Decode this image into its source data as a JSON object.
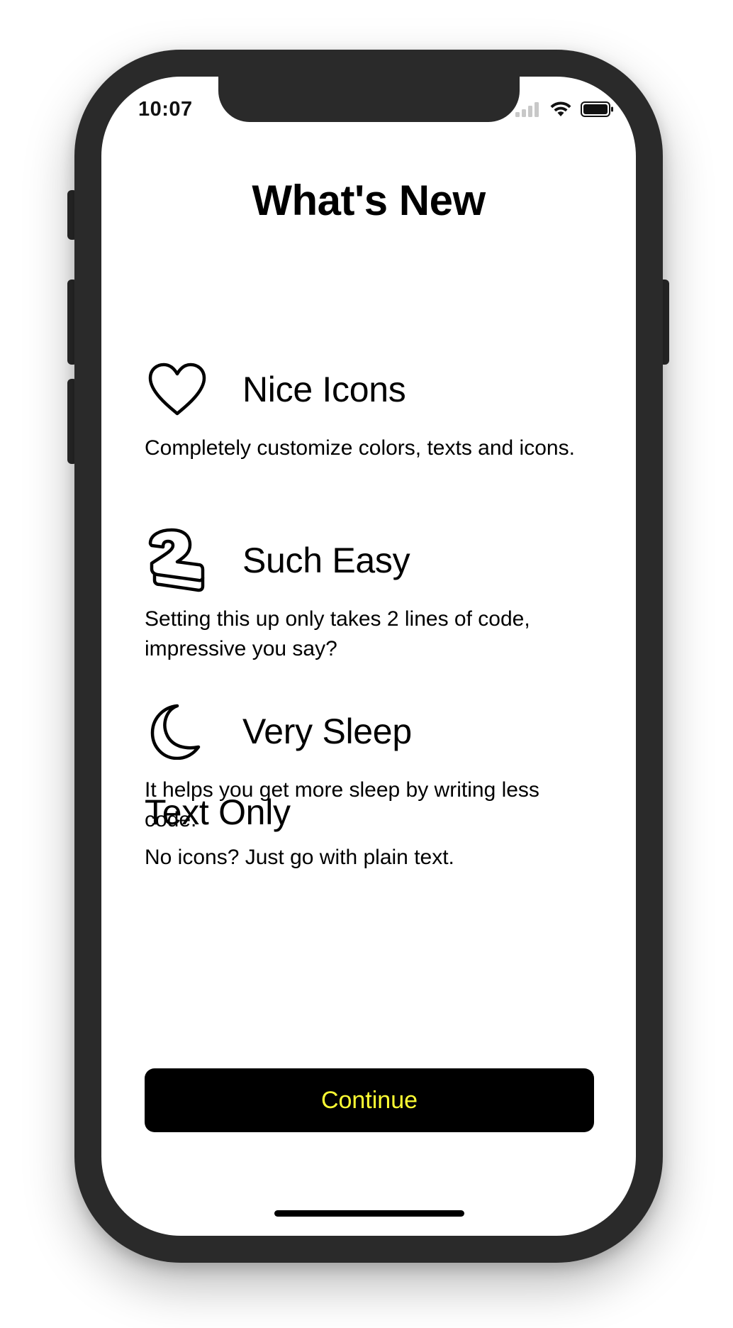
{
  "status_bar": {
    "time": "10:07",
    "icons": [
      "cellular-signal-icon",
      "wifi-icon",
      "battery-icon"
    ]
  },
  "page": {
    "title": "What's New"
  },
  "features": [
    {
      "icon": "heart-icon",
      "title": "Nice Icons",
      "description": "Completely customize colors, texts and icons."
    },
    {
      "icon": "number-two-icon",
      "title": "Such Easy",
      "description": "Setting this up only takes 2 lines of code, impressive you say?"
    },
    {
      "icon": "moon-icon",
      "title": "Very Sleep",
      "description": "It helps you get more sleep by writing less code."
    },
    {
      "icon": "",
      "title": "Text Only",
      "description": "No icons? Just go with plain text."
    }
  ],
  "continue_button": {
    "label": "Continue",
    "background": "#000000",
    "text_color": "#ffff33"
  }
}
